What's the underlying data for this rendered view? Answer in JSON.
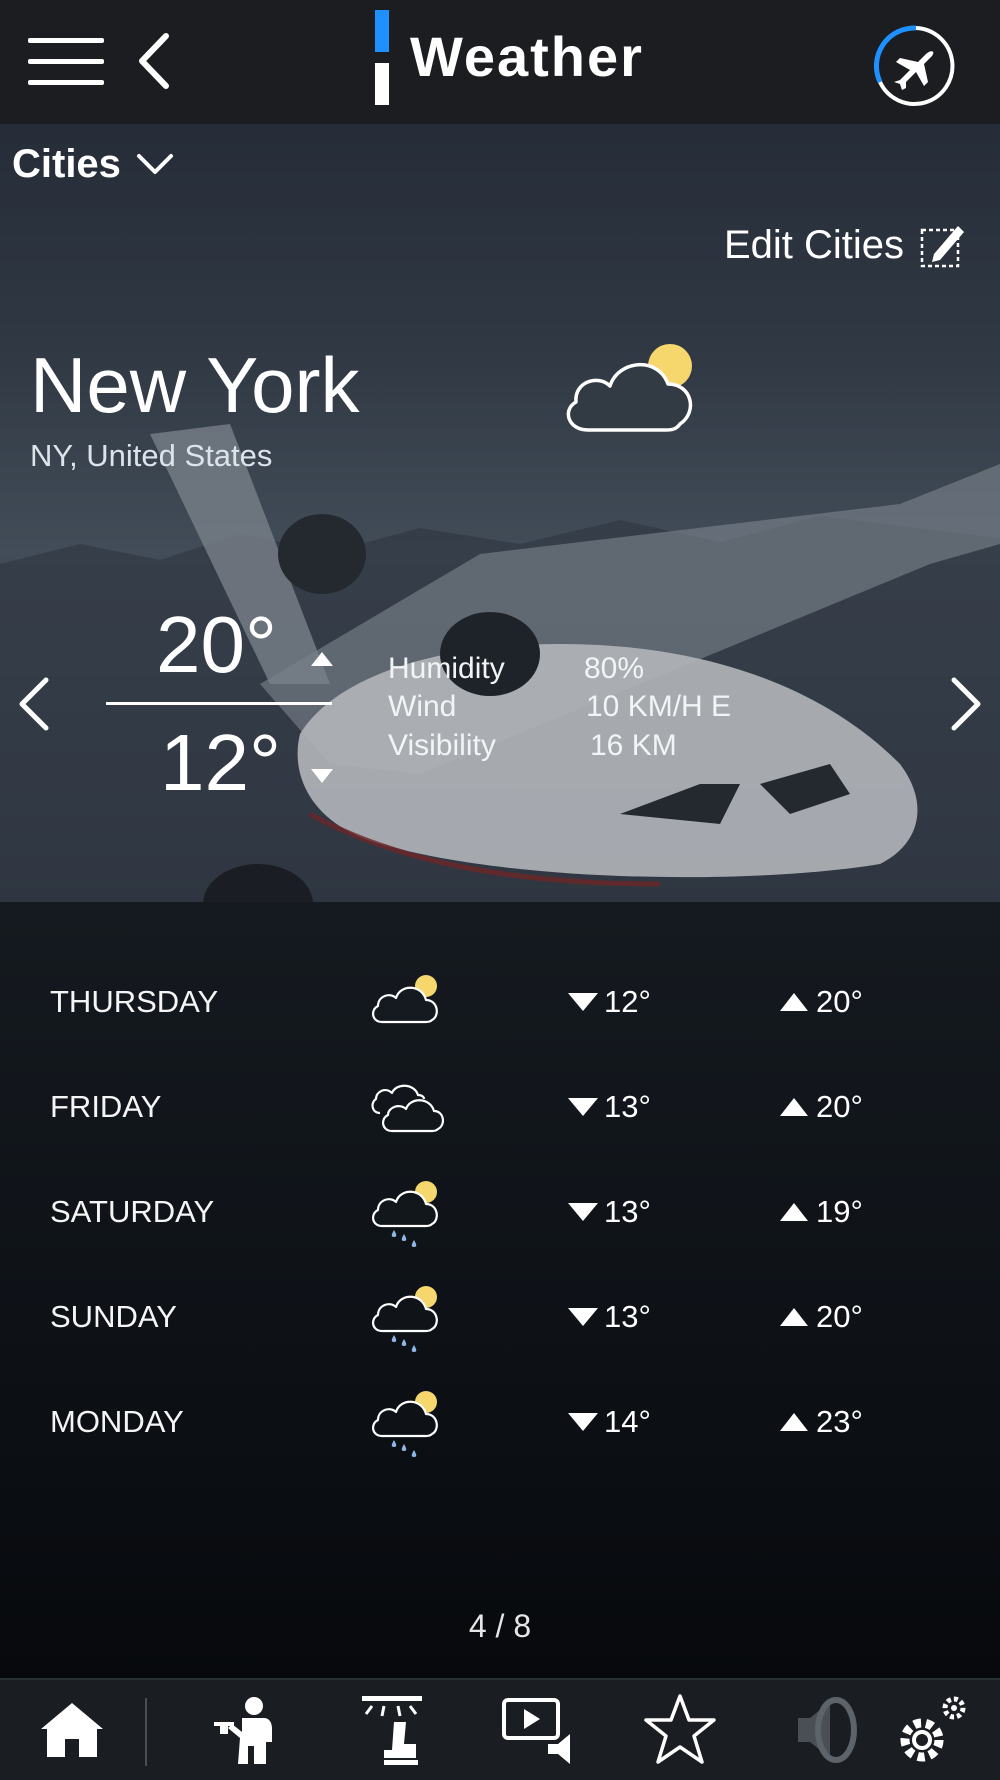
{
  "header": {
    "title": "Weather",
    "menu_icon": "hamburger-menu-icon",
    "back_icon": "back-chevron-icon",
    "flight_icon": "flight-progress-icon",
    "accent_color": "#1e90ff"
  },
  "cities": {
    "dropdown_label": "Cities",
    "edit_label": "Edit Cities"
  },
  "location": {
    "name": "New York",
    "region": "NY, United States",
    "condition_icon": "partly-cloudy-icon"
  },
  "current": {
    "high": "20°",
    "low": "12°",
    "details": [
      {
        "label": "Humidity",
        "value": "80%"
      },
      {
        "label": "Wind",
        "value": "10 KM/H E"
      },
      {
        "label": "Visibility",
        "value": "16 KM"
      }
    ]
  },
  "forecast": [
    {
      "day": "THURSDAY",
      "icon": "partly-cloudy-icon",
      "low": "12°",
      "high": "20°"
    },
    {
      "day": "FRIDAY",
      "icon": "cloudy-icon",
      "low": "13°",
      "high": "20°"
    },
    {
      "day": "SATURDAY",
      "icon": "sun-rain-icon",
      "low": "13°",
      "high": "19°"
    },
    {
      "day": "SUNDAY",
      "icon": "sun-rain-icon",
      "low": "13°",
      "high": "20°"
    },
    {
      "day": "MONDAY",
      "icon": "sun-rain-icon",
      "low": "14°",
      "high": "23°"
    }
  ],
  "pager": "4 / 8",
  "bottom_nav": [
    "home-icon",
    "crew-service-icon",
    "seat-light-icon",
    "media-icon",
    "favorites-icon",
    "volume-icon",
    "settings-icon"
  ]
}
